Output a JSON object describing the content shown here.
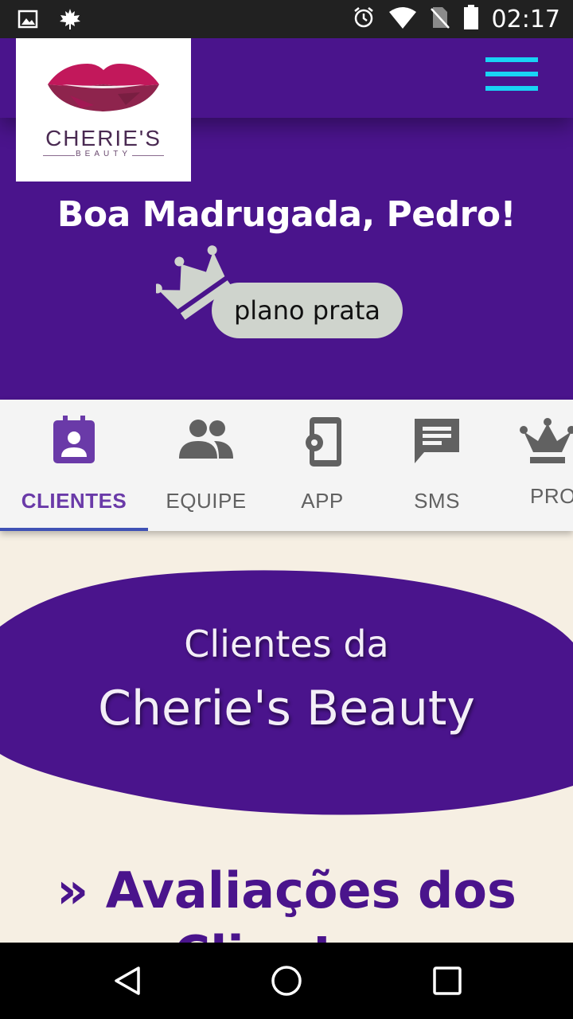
{
  "status_bar": {
    "time": "02:17",
    "icons": [
      "image-icon",
      "maple-leaf-icon",
      "alarm-icon",
      "wifi-icon",
      "no-sim-icon",
      "battery-icon"
    ]
  },
  "header": {
    "logo": {
      "brand": "CHERIE'S",
      "sub": "BEAUTY"
    },
    "menu_icon": "hamburger-menu-icon",
    "greeting": "Boa Madrugada, Pedro!",
    "plan_label": "plano prata",
    "plan_icon": "crown-icon"
  },
  "tabs": [
    {
      "label": "CLIENTES",
      "icon": "contact-calendar-icon",
      "active": true
    },
    {
      "label": "EQUIPE",
      "icon": "people-icon",
      "active": false
    },
    {
      "label": "APP",
      "icon": "phone-settings-icon",
      "active": false
    },
    {
      "label": "SMS",
      "icon": "chat-message-icon",
      "active": false
    },
    {
      "label": "PRO",
      "icon": "crown-icon",
      "active": false
    }
  ],
  "content": {
    "title_line1": "Clientes da",
    "title_line2": "Cherie's Beauty",
    "section_heading": "» Avaliações dos Clientes"
  },
  "nav": {
    "icons": [
      "back-icon",
      "home-icon",
      "recents-icon"
    ]
  },
  "colors": {
    "primary": "#4a148c",
    "accent": "#19d3f5",
    "tab_active": "#6a3aa8",
    "tab_indicator": "#3f51b5",
    "background": "#f6efe3",
    "pill": "#cfd4cd"
  }
}
